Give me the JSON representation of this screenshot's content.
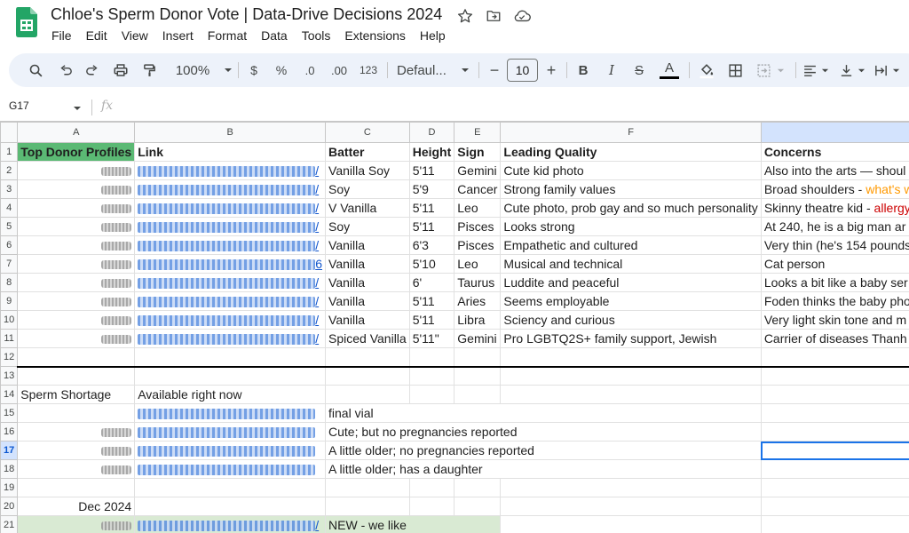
{
  "app": {
    "title": "Chloe's Sperm Donor Vote | Data-Drive Decisions 2024",
    "menu": [
      "File",
      "Edit",
      "View",
      "Insert",
      "Format",
      "Data",
      "Tools",
      "Extensions",
      "Help"
    ]
  },
  "toolbar": {
    "zoom": "100%",
    "currency": "$",
    "percent": "%",
    "decrease_decimals": ".0",
    "increase_decimals": ".00",
    "number_format": "123",
    "font": "Defaul...",
    "font_size": "10",
    "minus": "−",
    "plus": "+",
    "bold": "B",
    "italic": "I",
    "strike": "S",
    "text_color": "A"
  },
  "formula_bar": {
    "cell_ref": "G17",
    "fx": "fx",
    "value": ""
  },
  "sheet": {
    "columns": [
      "A",
      "B",
      "C",
      "D",
      "E",
      "F",
      ""
    ],
    "selected_row": 17,
    "selected_col": 7,
    "row_numbers": [
      "1",
      "2",
      "3",
      "4",
      "5",
      "6",
      "7",
      "8",
      "9",
      "10",
      "11",
      "12",
      "13",
      "14",
      "15",
      "16",
      "17",
      "18",
      "19",
      "20",
      "21"
    ],
    "header_row": {
      "a": "Top Donor Profiles",
      "b": "Link",
      "c": "Batter",
      "d": "Height",
      "e": "Sign",
      "f": "Leading Quality",
      "g": "Concerns"
    },
    "donors": [
      {
        "link_tail": "/",
        "batter": "Vanilla Soy",
        "height": "5'11",
        "sign": "Gemini",
        "quality": "Cute kid photo",
        "concern": "Also into the arts — shoul",
        "concern_orange": "",
        "concern_red": ""
      },
      {
        "link_tail": "/",
        "batter": "Soy",
        "height": "5'9",
        "sign": "Cancer",
        "quality": "Strong family values",
        "concern": "Broad shoulders - ",
        "concern_orange": "what's w",
        "concern_red": ""
      },
      {
        "link_tail": "/",
        "batter": "V Vanilla",
        "height": "5'11",
        "sign": "Leo",
        "quality": "Cute photo, prob gay and so much personality",
        "concern": "Skinny theatre kid - ",
        "concern_orange": "",
        "concern_red": "allergy"
      },
      {
        "link_tail": "/",
        "batter": "Soy",
        "height": "5'11",
        "sign": "Pisces",
        "quality": "Looks strong",
        "concern": "At 240, he is a big man ar",
        "concern_orange": "",
        "concern_red": ""
      },
      {
        "link_tail": "/",
        "batter": "Vanilla",
        "height": "6'3",
        "sign": "Pisces",
        "quality": "Empathetic and cultured",
        "concern": "Very thin (he's 154 pounds",
        "concern_orange": "",
        "concern_red": ""
      },
      {
        "link_tail": "6",
        "batter": "Vanilla",
        "height": "5'10",
        "sign": "Leo",
        "quality": "Musical and technical",
        "concern": "Cat person",
        "concern_orange": "",
        "concern_red": ""
      },
      {
        "link_tail": "/",
        "batter": "Vanilla",
        "height": "6'",
        "sign": "Taurus",
        "quality": "Luddite and peaceful",
        "concern": "Looks a bit like a baby ser",
        "concern_orange": "",
        "concern_red": ""
      },
      {
        "link_tail": "/",
        "batter": "Vanilla",
        "height": "5'11",
        "sign": "Aries",
        "quality": "Seems employable",
        "concern": "Foden thinks the baby pho",
        "concern_orange": "",
        "concern_red": ""
      },
      {
        "link_tail": "/",
        "batter": "Vanilla",
        "height": "5'11",
        "sign": "Libra",
        "quality": "Sciency and curious",
        "concern": "Very light skin tone and m",
        "concern_orange": "",
        "concern_red": ""
      },
      {
        "link_tail": "/",
        "batter": "Spiced Vanilla",
        "height": "5'11\"",
        "sign": "Gemini",
        "quality": "Pro LGBTQ2S+ family support, Jewish",
        "concern": "Carrier of diseases Thanh",
        "concern_orange": "",
        "concern_red": ""
      }
    ],
    "shortage": {
      "label": "Sperm Shortage",
      "available": "Available right now",
      "rows": [
        {
          "note": "final vial"
        },
        {
          "note": "Cute; but no pregnancies reported"
        },
        {
          "note": "A little older; no pregnancies reported"
        },
        {
          "note": "A little older; has a daughter"
        }
      ]
    },
    "dec": {
      "label": "Dec 2024",
      "link_tail": "/",
      "note": "NEW - we like"
    }
  },
  "colors": {
    "green_header": "#5bb974",
    "green_row": "#d9ead3",
    "link": "#1155cc",
    "toolbar_bg": "#edf2fa",
    "selection": "#1a73e8"
  }
}
